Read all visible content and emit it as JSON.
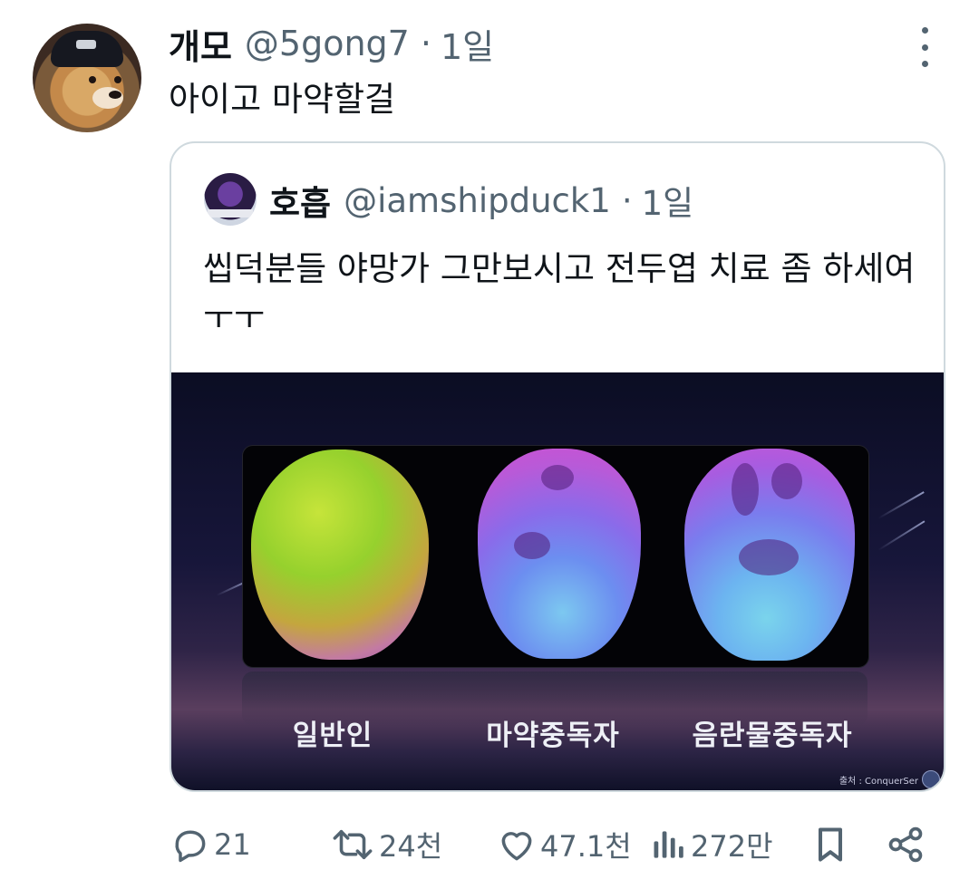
{
  "tweet": {
    "author_name": "개모",
    "handle": "@5gong7",
    "separator": "·",
    "time": "1일",
    "text": "아이고 마약할걸"
  },
  "quoted": {
    "author_name": "호흡",
    "handle": "@iamshipduck1",
    "separator": "·",
    "time": "1일",
    "text": "씹덕분들 야망가 그만보시고 전두엽 치료 좀 하세여ㅜㅜ",
    "media": {
      "labels": [
        "일반인",
        "마약중독자",
        "음란물중독자"
      ],
      "credit": "출처 : ConquerSer"
    }
  },
  "actions": {
    "replies": "21",
    "retweets": "24천",
    "likes": "47.1천",
    "views": "272만"
  },
  "colors": {
    "text": "#0f1419",
    "secondary": "#536471",
    "border": "#cfd9de"
  },
  "icons": [
    "more-options-icon",
    "reply-icon",
    "retweet-icon",
    "like-icon",
    "views-icon",
    "bookmark-icon",
    "share-icon"
  ]
}
